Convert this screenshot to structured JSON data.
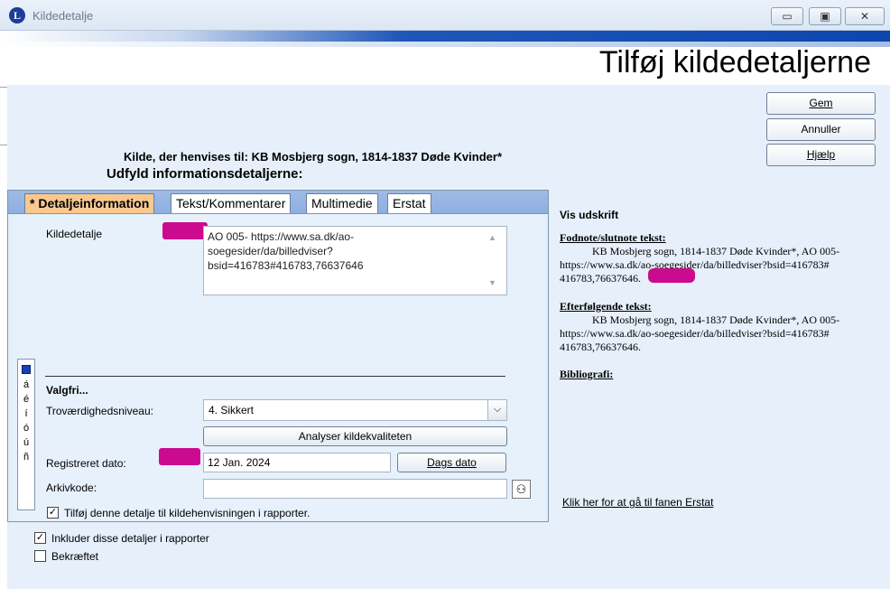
{
  "window": {
    "title": "Kildedetalje",
    "logo_letter": "L",
    "controls": {
      "minimize": "▭",
      "maximize": "▣",
      "close": "✕"
    }
  },
  "header": {
    "page_title": "Tilføj kildedetaljerne"
  },
  "buttons": {
    "save": "Gem",
    "cancel": "Annuller",
    "help": "Hjælp"
  },
  "source_line": "Kilde, der henvises til: KB Mosbjerg sogn, 1814-1837 Døde Kvinder*",
  "subheading": "Udfyld informationsdetaljerne:",
  "tabs": [
    {
      "label": "* Detaljeinformation",
      "active": true
    },
    {
      "label": "Tekst/Kommentarer",
      "active": false
    },
    {
      "label": "Multimedie",
      "active": false
    },
    {
      "label": "Erstat",
      "active": false
    }
  ],
  "form": {
    "detail_label": "Kildedetalje",
    "detail_lines": [
      "AO 005- https://www.sa.dk/ao-",
      "soegesider/da/billedviser?",
      "bsid=416783#416783,76637646"
    ],
    "optional_label": "Valgfri...",
    "reliability_label": "Troværdighedsniveau:",
    "reliability_value": "4.  Sikkert",
    "analyze_button": "Analyser kildekvaliteten",
    "date_label": "Registreret dato:",
    "date_value": "12 Jan. 2024",
    "today_button": "Dags dato",
    "archive_label": "Arkivkode:",
    "archive_value": "",
    "add_to_reports": {
      "label": "Tilføj denne detalje til kildehenvisningen i rapporter.",
      "checked": true
    }
  },
  "char_strip": [
    "á",
    "é",
    "í",
    "ó",
    "ú",
    "ñ"
  ],
  "bottom_options": [
    {
      "label": "Inkluder disse detaljer i rapporter",
      "checked": true
    },
    {
      "label": "Bekræftet",
      "checked": false
    }
  ],
  "preview": {
    "title": "Vis udskrift",
    "footnote_heading": "Fodnote/slutnote tekst:",
    "footnote_lines": [
      "KB Mosbjerg sogn, 1814-1837 Døde Kvinder*, AO 005-",
      "https://www.sa.dk/ao-soegesider/da/billedviser?bsid=416783#",
      "416783,76637646."
    ],
    "subsequent_heading": "Efterfølgende tekst:",
    "subsequent_lines": [
      "KB Mosbjerg sogn, 1814-1837 Døde Kvinder*, AO 005-",
      "https://www.sa.dk/ao-soegesider/da/billedviser?bsid=416783#",
      "416783,76637646."
    ],
    "bibliography_heading": "Bibliografi:",
    "link": "Klik her for at gå til fanen Erstat"
  },
  "colors": {
    "active_tab": "#f9c88f",
    "redaction": "#cc0a8f",
    "banner_blue": "#0c46ae"
  }
}
